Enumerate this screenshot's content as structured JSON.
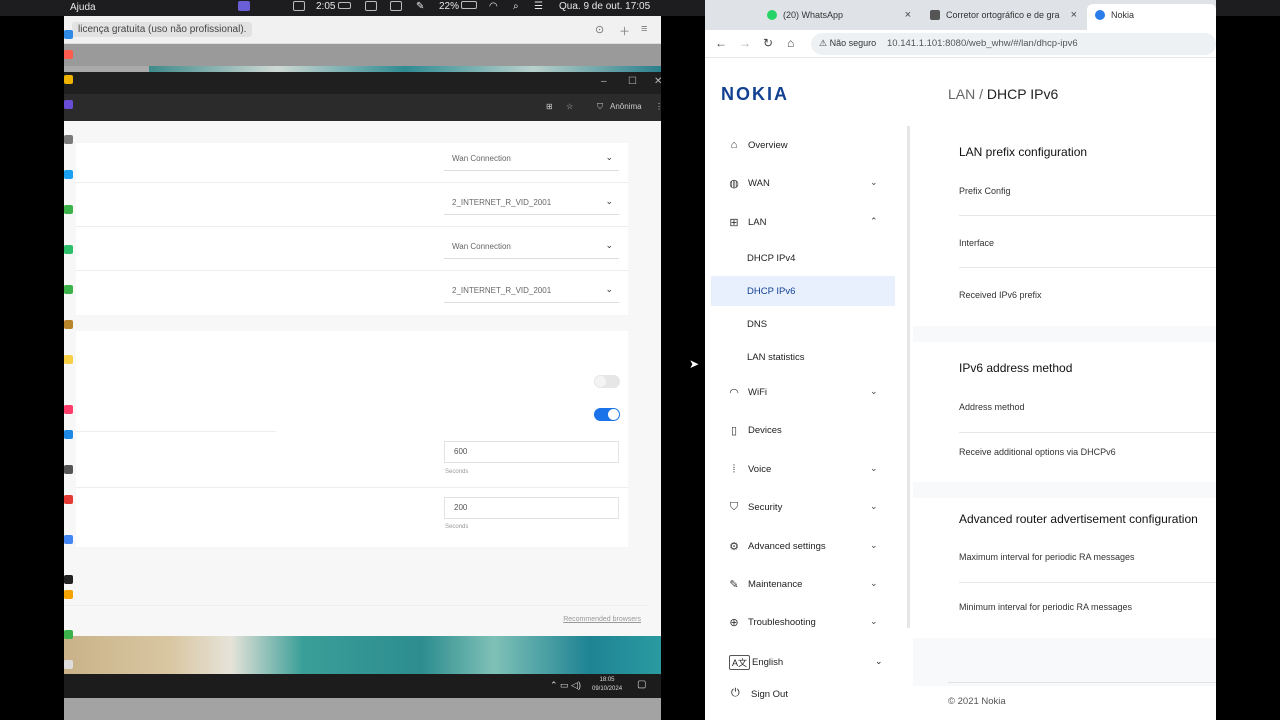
{
  "menubar": {
    "app_menu": "Ajuda",
    "battery_time": "2:05",
    "battery_percent": "22%",
    "datetime": "Qua. 9 de out.  17:05"
  },
  "left_window": {
    "license_text": "licença gratuita (uso não profissional).",
    "inner_toolbar_label": "Anônima",
    "selects": [
      "Wan Connection",
      "2_INTERNET_R_VID_2001",
      "Wan Connection",
      "2_INTERNET_R_VID_2001"
    ],
    "inputs": [
      {
        "value": "600",
        "unit": "Seconds"
      },
      {
        "value": "200",
        "unit": "Seconds"
      }
    ],
    "recommended_link": "Recommended browsers",
    "taskbar_time": "18:05",
    "taskbar_date": "09/10/2024"
  },
  "browser": {
    "tabs": [
      {
        "label": "(20) WhatsApp",
        "color": "#25d366"
      },
      {
        "label": "Corretor ortográfico e de gra",
        "color": "#555555"
      },
      {
        "label": "Nokia",
        "color": "#2b7de9"
      }
    ],
    "security_label": "Não seguro",
    "url": "10.141.1.101:8080/web_whw/#/lan/dhcp-ipv6"
  },
  "nokia": {
    "logo": "NOKIA",
    "breadcrumb_parent": "LAN /",
    "page_title": "DHCP IPv6",
    "brand_color": "#124191",
    "nav": [
      {
        "label": "Overview",
        "icon": "home-icon"
      },
      {
        "label": "WAN",
        "icon": "globe-icon"
      },
      {
        "label": "LAN",
        "icon": "network-icon"
      },
      {
        "label": "WiFi",
        "icon": "wifi-icon"
      },
      {
        "label": "Devices",
        "icon": "devices-icon"
      },
      {
        "label": "Voice",
        "icon": "voice-icon"
      },
      {
        "label": "Security",
        "icon": "shield-icon"
      },
      {
        "label": "Advanced settings",
        "icon": "gear-icon"
      },
      {
        "label": "Maintenance",
        "icon": "wrench-icon"
      },
      {
        "label": "Troubleshooting",
        "icon": "target-icon"
      }
    ],
    "lan_sub": [
      "DHCP IPv4",
      "DHCP IPv6",
      "DNS",
      "LAN statistics"
    ],
    "language": "English",
    "signout": "Sign Out",
    "sections": [
      {
        "title": "LAN prefix configuration",
        "fields": [
          "Prefix Config",
          "Interface",
          "Received IPv6 prefix"
        ]
      },
      {
        "title": "IPv6 address method",
        "fields": [
          "Address method",
          "Receive additional options via DHCPv6"
        ]
      },
      {
        "title": "Advanced router advertisement configuration",
        "fields": [
          "Maximum interval for periodic RA messages",
          "Minimum interval for periodic RA messages"
        ]
      }
    ],
    "footer": "© 2021 Nokia"
  }
}
